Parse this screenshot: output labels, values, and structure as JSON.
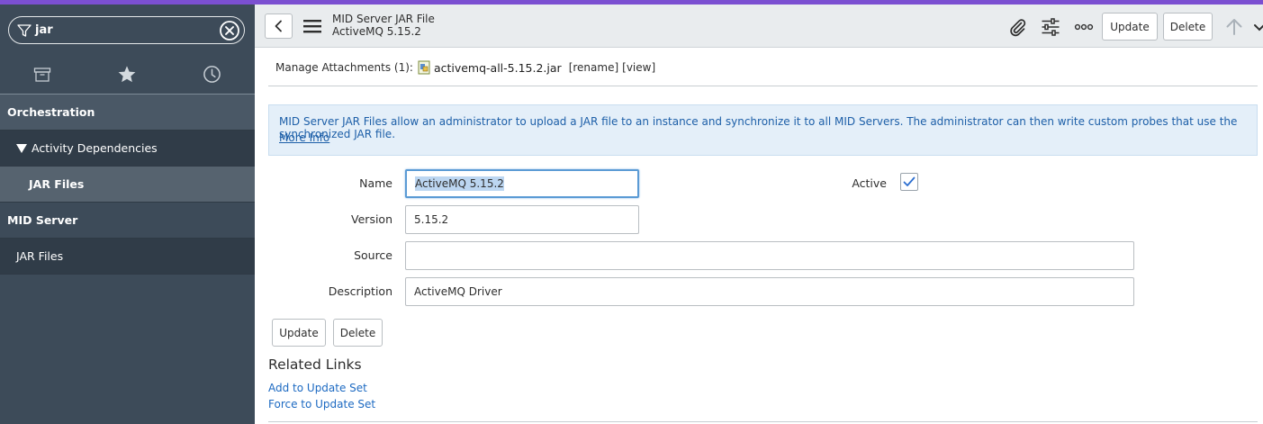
{
  "colors": {
    "accent": "#7b4fd1",
    "sidebar_bg": "#3d4b59",
    "link_blue": "#1d6ac2",
    "banner_bg": "#e4eff9",
    "focus_blue": "#5b9bd5"
  },
  "sidebar": {
    "filter": {
      "value": "jar",
      "icon": "filter-icon",
      "clear_icon": "clear-circle-icon"
    },
    "tabs": [
      {
        "icon": "archive-icon",
        "label": "All"
      },
      {
        "icon": "star-icon",
        "label": "Favorites"
      },
      {
        "icon": "clock-icon",
        "label": "History"
      }
    ],
    "items": [
      {
        "label": "Orchestration",
        "level": 0
      },
      {
        "label": "Activity Dependencies",
        "level": 1,
        "expanded": true
      },
      {
        "label": "JAR Files",
        "level": 2,
        "selected": true
      },
      {
        "label": "MID Server",
        "level": 0
      },
      {
        "label": "JAR Files",
        "level": 1
      }
    ]
  },
  "header": {
    "title": "MID Server JAR File",
    "subtitle": "ActiveMQ 5.15.2",
    "icons": [
      "back-icon",
      "hamburger-icon",
      "paperclip-icon",
      "sliders-icon",
      "more-icon",
      "arrow-up-icon",
      "chevron-down-icon"
    ],
    "update_label": "Update",
    "delete_label": "Delete"
  },
  "attachments": {
    "prefix": "Manage Attachments (1):",
    "file_name": "activemq-all-5.15.2.jar",
    "rename_label": "[rename]",
    "view_label": "[view]"
  },
  "banner": {
    "text": "MID Server JAR Files allow an administrator to upload a JAR file to an instance and synchronize it to all MID Servers. The administrator can then write custom probes that use the synchronized JAR file.",
    "link": "More Info"
  },
  "form": {
    "name_label": "Name",
    "name_value": "ActiveMQ 5.15.2",
    "version_label": "Version",
    "version_value": "5.15.2",
    "source_label": "Source",
    "source_value": "",
    "description_label": "Description",
    "description_value": "ActiveMQ Driver",
    "active_label": "Active",
    "active_checked": true,
    "update_label": "Update",
    "delete_label": "Delete"
  },
  "related_links": {
    "title": "Related Links",
    "links": [
      "Add to Update Set",
      "Force to Update Set"
    ]
  }
}
